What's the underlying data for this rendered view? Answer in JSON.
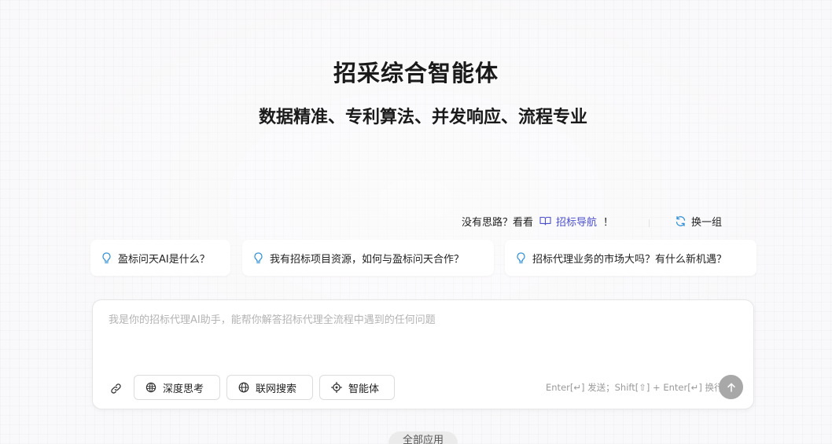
{
  "hero": {
    "title": "招采综合智能体",
    "subtitle": "数据精准、专利算法、并发响应、流程专业"
  },
  "hint": {
    "prefix": "没有思路？看看",
    "link_label": "招标导航",
    "suffix": "！",
    "refresh_label": "换一组"
  },
  "suggestions": [
    {
      "label": "盈标问天AI是什么？"
    },
    {
      "label": "我有招标项目资源，如何与盈标问天合作？"
    },
    {
      "label": "招标代理业务的市场大吗？有什么新机遇？"
    }
  ],
  "chat": {
    "placeholder": "我是你的招标代理AI助手，能帮你解答招标代理全流程中遇到的任何问题",
    "tools": [
      {
        "label": "深度思考",
        "icon": "deep-think-icon"
      },
      {
        "label": "联网搜索",
        "icon": "globe-icon"
      },
      {
        "label": "智能体",
        "icon": "agent-icon"
      }
    ],
    "shortcut_hint": "Enter[↵] 发送；Shift[⇧] + Enter[↵] 换行"
  },
  "footer": {
    "all_apps_label": "全部应用"
  },
  "colors": {
    "link": "#4a4fcf",
    "send_disabled": "#a8a8a8",
    "icon_accent": "#2f8fd8"
  }
}
